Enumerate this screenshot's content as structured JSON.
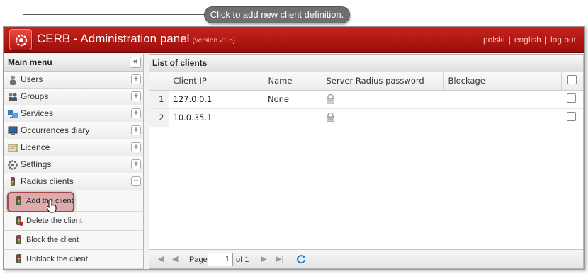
{
  "callout": {
    "text": "Click to add new client definition."
  },
  "header": {
    "title": "CERB - Administration panel",
    "version": "(version v1.5)",
    "links": [
      "polski",
      "english",
      "log out"
    ],
    "separator": "|"
  },
  "sidebar": {
    "title": "Main menu",
    "collapse_symbol": "«",
    "items": [
      {
        "label": "Users",
        "icon": "user-icon",
        "toggle": "+"
      },
      {
        "label": "Groups",
        "icon": "group-icon",
        "toggle": "+"
      },
      {
        "label": "Services",
        "icon": "services-icon",
        "toggle": "+"
      },
      {
        "label": "Occurrences diary",
        "icon": "monitor-icon",
        "toggle": "+"
      },
      {
        "label": "Licence",
        "icon": "licence-icon",
        "toggle": "+"
      },
      {
        "label": "Settings",
        "icon": "gear-icon",
        "toggle": "+"
      },
      {
        "label": "Radius clients",
        "icon": "traffic-light-icon",
        "toggle": "−"
      }
    ],
    "subitems": [
      {
        "label": "Add the client",
        "icon": "add-client-icon"
      },
      {
        "label": "Delete the client",
        "icon": "delete-client-icon"
      },
      {
        "label": "Block the client",
        "icon": "block-client-icon"
      },
      {
        "label": "Unblock the client",
        "icon": "unblock-client-icon"
      }
    ]
  },
  "main": {
    "title": "List of clients",
    "columns": [
      "Client IP",
      "Name",
      "Server Radius password",
      "Blockage"
    ],
    "rows": [
      {
        "num": "1",
        "ip": "127.0.0.1",
        "name": "None",
        "password_icon": "lock-icon",
        "blockage": ""
      },
      {
        "num": "2",
        "ip": "10.0.35.1",
        "name": "",
        "password_icon": "lock-icon",
        "blockage": ""
      }
    ]
  },
  "pager": {
    "page_label": "Page",
    "page_value": "1",
    "of_label": "of 1"
  },
  "colors": {
    "header_red": "#b51a14",
    "callout_grey": "#6f6f6f",
    "highlight": "#a04848"
  }
}
